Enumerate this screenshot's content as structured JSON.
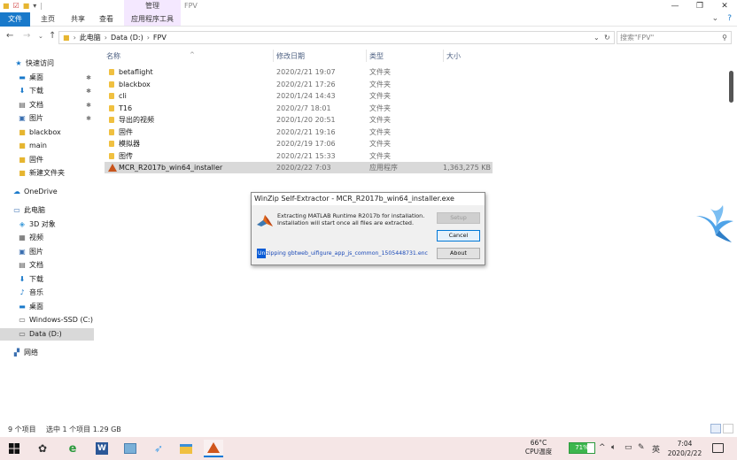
{
  "window": {
    "title": "FPV",
    "context_tab_group": "管理",
    "controls": {
      "minimize": "—",
      "maximize": "❐",
      "close": "✕"
    }
  },
  "ribbon": {
    "tabs": [
      "文件",
      "主页",
      "共享",
      "查看",
      "应用程序工具"
    ]
  },
  "address": {
    "path": [
      "此电脑",
      "Data (D:)",
      "FPV"
    ],
    "search_placeholder": "搜索\"FPV\""
  },
  "sidebar": {
    "items": [
      {
        "label": "快速访问",
        "icon": "star-icon",
        "level": 0
      },
      {
        "label": "桌面",
        "icon": "desktop-icon",
        "pinned": true,
        "level": 1
      },
      {
        "label": "下载",
        "icon": "download-icon",
        "pinned": true,
        "level": 1
      },
      {
        "label": "文档",
        "icon": "document-icon",
        "pinned": true,
        "level": 1
      },
      {
        "label": "图片",
        "icon": "picture-icon",
        "pinned": true,
        "level": 1
      },
      {
        "label": "blackbox",
        "icon": "folder-icon",
        "level": 1
      },
      {
        "label": "main",
        "icon": "folder-icon",
        "level": 1
      },
      {
        "label": "固件",
        "icon": "folder-icon",
        "level": 1
      },
      {
        "label": "新建文件夹",
        "icon": "folder-icon",
        "level": 1
      },
      {
        "label": "OneDrive",
        "icon": "cloud-icon",
        "level": 0
      },
      {
        "label": "此电脑",
        "icon": "computer-icon",
        "level": 0
      },
      {
        "label": "3D 对象",
        "icon": "cube-icon",
        "level": 1
      },
      {
        "label": "视频",
        "icon": "video-icon",
        "level": 1
      },
      {
        "label": "图片",
        "icon": "picture-icon",
        "level": 1
      },
      {
        "label": "文档",
        "icon": "document-icon",
        "level": 1
      },
      {
        "label": "下载",
        "icon": "download-icon",
        "level": 1
      },
      {
        "label": "音乐",
        "icon": "music-icon",
        "level": 1
      },
      {
        "label": "桌面",
        "icon": "desktop-icon",
        "level": 1
      },
      {
        "label": "Windows-SSD (C:)",
        "icon": "drive-icon",
        "level": 1
      },
      {
        "label": "Data (D:)",
        "icon": "drive-icon",
        "level": 1,
        "selected": true
      },
      {
        "label": "网络",
        "icon": "network-icon",
        "level": 0
      }
    ]
  },
  "columns": {
    "name": "名称",
    "date": "修改日期",
    "type": "类型",
    "size": "大小"
  },
  "files": [
    {
      "name": "betaflight",
      "date": "2020/2/21 19:07",
      "type": "文件夹",
      "size": ""
    },
    {
      "name": "blackbox",
      "date": "2020/2/21 17:26",
      "type": "文件夹",
      "size": ""
    },
    {
      "name": "cli",
      "date": "2020/1/24 14:43",
      "type": "文件夹",
      "size": ""
    },
    {
      "name": "T16",
      "date": "2020/2/7 18:01",
      "type": "文件夹",
      "size": ""
    },
    {
      "name": "导出的视频",
      "date": "2020/1/20 20:51",
      "type": "文件夹",
      "size": ""
    },
    {
      "name": "固件",
      "date": "2020/2/21 19:16",
      "type": "文件夹",
      "size": ""
    },
    {
      "name": "模拟器",
      "date": "2020/2/19 17:06",
      "type": "文件夹",
      "size": ""
    },
    {
      "name": "图传",
      "date": "2020/2/21 15:33",
      "type": "文件夹",
      "size": ""
    },
    {
      "name": "MCR_R2017b_win64_installer",
      "date": "2020/2/22 7:03",
      "type": "应用程序",
      "size": "1,363,275 KB",
      "selected": true
    }
  ],
  "dialog": {
    "title": "WinZip Self-Extractor - MCR_R2017b_win64_installer.exe",
    "message_line1": "Extracting MATLAB Runtime R2017b for installation.",
    "message_line2": "Installation will start once all files are extracted.",
    "buttons": {
      "setup": "Setup",
      "cancel": "Cancel",
      "about": "About"
    },
    "status_caret": "Un",
    "status_rest": "zipping gbtweb_uifigure_app_js_common_1505448731.enc"
  },
  "statusbar": {
    "item_count": "9 个项目",
    "selection": "选中 1 个项目  1.29 GB"
  },
  "tray": {
    "temp": "66°C",
    "temp_label": "CPU温度",
    "battery_percent": 71,
    "battery_label": "71%",
    "ime": "英",
    "time": "7:04",
    "date": "2020/2/22"
  }
}
